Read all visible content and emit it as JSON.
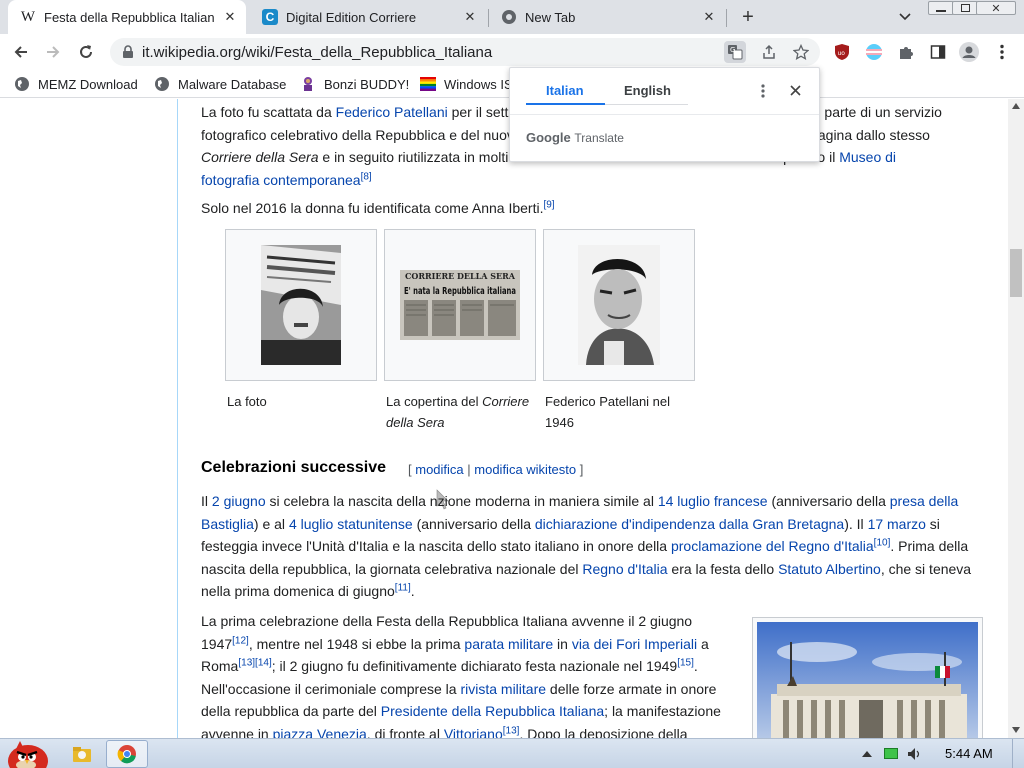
{
  "browser": {
    "tabs": [
      {
        "title": "Festa della Repubblica Italiana",
        "icon": "wikipedia-w"
      },
      {
        "title": "Digital Edition Corriere",
        "icon": "corriere-c"
      },
      {
        "title": "New Tab",
        "icon": "chrome"
      }
    ],
    "url": "it.wikipedia.org/wiki/Festa_della_Repubblica_Italiana",
    "bookmarks": [
      {
        "label": "MEMZ Download"
      },
      {
        "label": "Malware Database"
      },
      {
        "label": "Bonzi BUDDY!"
      },
      {
        "label": "Windows IS"
      }
    ]
  },
  "translate_popup": {
    "tab_source": "Italian",
    "tab_target": "English",
    "brand_google": "Google",
    "brand_translate": "Translate"
  },
  "article": {
    "p1": {
      "t1": "La foto fu scattata da ",
      "l1": "Federico Patellani",
      "t2": " per il sett",
      "t3": "parte di un servizio",
      "t4": "fotografico celebrativo della Repubblica e del nuov",
      "t5": "agina dallo stesso",
      "i1": "Corriere della Sera",
      "t6": " e in seguito riutilizzata in molti",
      "t7": "ervato presso il ",
      "l2": "Museo di",
      "l3": "fotografia contemporanea",
      "sup1": "[8]"
    },
    "p2": {
      "text": "Solo nel 2016 la donna fu identificata come Anna Iberti.",
      "sup": "[9]"
    },
    "gallery": [
      {
        "caption": "La foto"
      },
      {
        "caption_prefix": "La copertina del ",
        "caption_italic": "Corriere della Sera"
      },
      {
        "caption": "Federico Patellani nel 1946"
      }
    ],
    "newspaper": {
      "masthead": "CORRIERE DELLA SERA",
      "headline": "E' nata la Repubblica italiana"
    },
    "heading": "Celebrazioni successive",
    "edit": {
      "open": "[ ",
      "link1": "modifica",
      "bar": " | ",
      "link2": "modifica wikitesto",
      "close": " ]"
    },
    "p3": {
      "a": "Il ",
      "l1": "2 giugno",
      "b": " si celebra la nascita della n",
      "c": "zione moderna in maniera simile al ",
      "l2": "14 luglio francese",
      "d": " (anniversario della ",
      "l3": "presa della Bastiglia",
      "e": ") e al ",
      "l4": "4 luglio statunitense",
      "f": " (anniversario della ",
      "l5": "dichiarazione d'indipendenza dalla Gran Bretagna",
      "g": "). Il ",
      "l6": "17 marzo",
      "h": " si festeggia invece l'Unità d'Italia e la nascita dello stato italiano in onore della ",
      "l7": "proclamazione del Regno d'Italia",
      "s1": "[10]",
      "i": ". Prima della nascita della repubblica, la giornata celebrativa nazionale del ",
      "l8": "Regno d'Italia",
      "j": " era la festa dello ",
      "l9": "Statuto Albertino",
      "k": ", che si teneva nella prima domenica di giugno",
      "s2": "[11]",
      "m": "."
    },
    "p4": {
      "a": "La prima celebrazione della Festa della Repubblica Italiana avvenne il 2 giugno 1947",
      "s1": "[12]",
      "b": ", mentre nel 1948 si ebbe la prima ",
      "l1": "parata militare",
      "c": " in ",
      "l2": "via dei Fori Imperiali",
      "d": " a Roma",
      "s2": "[13][14]",
      "e": "; il 2 giugno fu definitivamente dichiarato festa nazionale nel 1949",
      "s3": "[15]",
      "f": ". Nell'occasione il cerimoniale comprese la ",
      "l3": "rivista militare",
      "g": " delle forze armate in onore della repubblica da parte del ",
      "l4": "Presidente della Repubblica Italiana",
      "h": "; la manifestazione avvenne in ",
      "l5": "piazza Venezia",
      "i": ", di fronte al ",
      "l6": "Vittoriano",
      "s4": "[13]",
      "j": ". Dopo la deposizione della"
    }
  },
  "taskbar": {
    "clock": "5:44 AM"
  },
  "colors": {
    "link": "#0645ad",
    "accent": "#1a73e8",
    "tabstrip": "#dee1e6"
  }
}
